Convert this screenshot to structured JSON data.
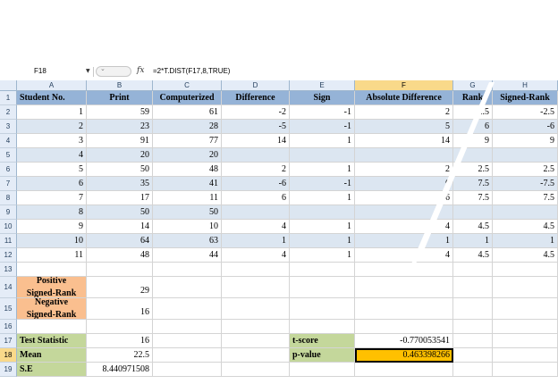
{
  "formula_bar": {
    "cell_ref": "F18",
    "fx_icon": "fx-icon",
    "formula": "=2*T.DIST(F17,8,TRUE)"
  },
  "columns": [
    "A",
    "B",
    "C",
    "D",
    "E",
    "F",
    "G",
    "H"
  ],
  "headers": [
    "Student No.",
    "Print",
    "Computerized",
    "Difference",
    "Sign",
    "Absolute Difference",
    "Rank",
    "Signed-Rank"
  ],
  "data_rows": [
    [
      "1",
      "59",
      "61",
      "-2",
      "-1",
      "2",
      "2.5",
      "-2.5"
    ],
    [
      "2",
      "23",
      "28",
      "-5",
      "-1",
      "5",
      "6",
      "-6"
    ],
    [
      "3",
      "91",
      "77",
      "14",
      "1",
      "14",
      "9",
      "9"
    ],
    [
      "4",
      "20",
      "20",
      "",
      "",
      "",
      "",
      ""
    ],
    [
      "5",
      "50",
      "48",
      "2",
      "1",
      "2",
      "2.5",
      "2.5"
    ],
    [
      "6",
      "35",
      "41",
      "-6",
      "-1",
      "6",
      "7.5",
      "-7.5"
    ],
    [
      "7",
      "17",
      "11",
      "6",
      "1",
      "6",
      "7.5",
      "7.5"
    ],
    [
      "8",
      "50",
      "50",
      "",
      "",
      "",
      "",
      ""
    ],
    [
      "9",
      "14",
      "10",
      "4",
      "1",
      "4",
      "4.5",
      "4.5"
    ],
    [
      "10",
      "64",
      "63",
      "1",
      "1",
      "1",
      "1",
      "1"
    ],
    [
      "11",
      "48",
      "44",
      "4",
      "1",
      "4",
      "4.5",
      "4.5"
    ]
  ],
  "summary": {
    "positive_label_1": "Positive",
    "positive_label_2": "Signed-Rank",
    "positive_value": "29",
    "negative_label_1": "Negative",
    "negative_label_2": "Signed-Rank",
    "negative_value": "16",
    "test_statistic_label": "Test Statistic",
    "test_statistic_value": "16",
    "mean_label": "Mean",
    "mean_value": "22.5",
    "se_label": "S.E",
    "se_value": "8.440971508",
    "t_score_label": "t-score",
    "t_score_value": "-0.770053541",
    "p_value_label": "p-value",
    "p_value_value": "0.463398266"
  },
  "row_numbers": [
    "1",
    "2",
    "3",
    "4",
    "5",
    "6",
    "7",
    "8",
    "9",
    "10",
    "11",
    "12",
    "13",
    "14",
    "15",
    "16",
    "17",
    "18",
    "19"
  ],
  "selected_cell": "F18",
  "colors": {
    "header_blue": "#95b3d7",
    "band_light": "#dce6f1",
    "peach": "#fabf8f",
    "green": "#c4d79b",
    "selected_orange": "#ffc000"
  }
}
